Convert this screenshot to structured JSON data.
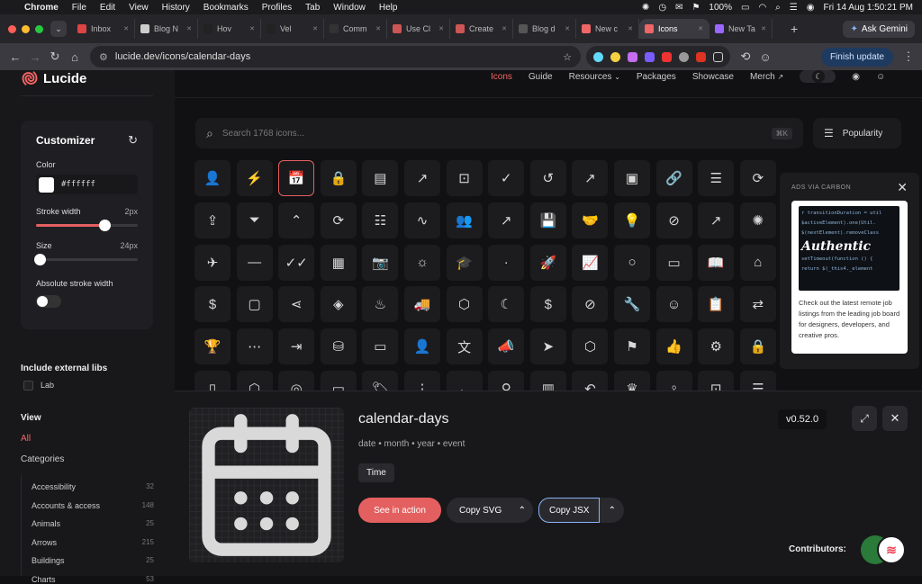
{
  "menubar": {
    "app": "Chrome",
    "items": [
      "File",
      "Edit",
      "View",
      "History",
      "Bookmarks",
      "Profiles",
      "Tab",
      "Window",
      "Help"
    ],
    "battery": "100%",
    "datetime": "Fri 14 Aug  1:50:21 PM"
  },
  "tabs": [
    {
      "label": "Inbox",
      "color": "#d44"
    },
    {
      "label": "Blog N",
      "color": "#ccc"
    },
    {
      "label": "Hov",
      "color": "#222"
    },
    {
      "label": "Vel",
      "color": "#222"
    },
    {
      "label": "Comm",
      "color": "#333"
    },
    {
      "label": "Use Cl",
      "color": "#c55"
    },
    {
      "label": "Create",
      "color": "#c55"
    },
    {
      "label": "Blog d",
      "color": "#555"
    },
    {
      "label": "New c",
      "color": "#e66"
    },
    {
      "label": "Icons",
      "color": "#e66",
      "active": true
    },
    {
      "label": "New Ta",
      "color": "#96f"
    }
  ],
  "browser": {
    "ask_gemini": "Ask Gemini",
    "url": "lucide.dev/icons/calendar-days",
    "finish_update": "Finish update"
  },
  "site": {
    "logo": "Lucide",
    "nav": [
      "Icons",
      "Guide",
      "Resources",
      "Packages",
      "Showcase",
      "Merch"
    ],
    "search_placeholder": "Search 1768 icons...",
    "search_shortcut": "⌘K",
    "sort_label": "Popularity"
  },
  "customizer": {
    "title": "Customizer",
    "color_label": "Color",
    "color_value": "#ffffff",
    "stroke_label": "Stroke width",
    "stroke_value": "2px",
    "stroke_fraction": 0.67,
    "size_label": "Size",
    "size_value": "24px",
    "size_fraction": 0.0,
    "absolute_label": "Absolute stroke width"
  },
  "libs": {
    "title": "Include external libs",
    "lab": "Lab"
  },
  "view": {
    "title": "View",
    "all": "All",
    "categories": "Categories"
  },
  "categories": [
    {
      "name": "Accessibility",
      "count": "32"
    },
    {
      "name": "Accounts & access",
      "count": "148"
    },
    {
      "name": "Animals",
      "count": "25"
    },
    {
      "name": "Arrows",
      "count": "215"
    },
    {
      "name": "Buildings",
      "count": "25"
    },
    {
      "name": "Charts",
      "count": "53"
    }
  ],
  "grid_icons": [
    [
      "👤",
      "⚡",
      "📅",
      "🔒",
      "▤",
      "↗",
      "⊡",
      "✓",
      "↺",
      "↗",
      "▣",
      "🔗",
      "☰",
      "⟳"
    ],
    [
      "⇪",
      "⏷",
      "⌃",
      "⟳",
      "☷",
      "∿",
      "👥",
      "↗",
      "💾",
      "🤝",
      "💡",
      "⊘",
      "↗",
      "✺"
    ],
    [
      "✈",
      "—",
      "✓✓",
      "▦",
      "📷",
      "☼",
      "🎓",
      "·",
      "🚀",
      "📈",
      "○",
      "▭",
      "📖",
      "⌂"
    ],
    [
      "$",
      "▢",
      "⋖",
      "◈",
      "♨",
      "🚚",
      "⬡",
      "☾",
      "$",
      "⊘",
      "🔧",
      "☺",
      "📋",
      "⇄"
    ],
    [
      "🏆",
      "⋯",
      "⇥",
      "⛁",
      "▭",
      "👤",
      "文",
      "📣",
      "➤",
      "⬡",
      "⚑",
      "👍",
      "⚙",
      "🔒"
    ],
    [
      "▯",
      "⬡",
      "◎",
      "▭",
      "🏷",
      "⋮",
      "←",
      "⚲",
      "▥",
      "↶",
      "♛",
      "♀",
      "⊡",
      "☰"
    ]
  ],
  "ads": {
    "header": "ADS VIA CARBON",
    "code": [
      "r transitionDuration = util",
      "$activeElement).one(Util.",
      "$(nextElement).removeClass",
      "Authentic",
      "setTimeout(function () {",
      "  return $(_this4._element"
    ],
    "text": "Check out the latest remote job listings from the leading job board for designers, developers, and creative pros."
  },
  "detail": {
    "name": "calendar-days",
    "tags": "date • month • year • event",
    "category": "Time",
    "version": "v0.52.0",
    "see_in_action": "See in action",
    "copy_svg": "Copy SVG",
    "copy_jsx": "Copy JSX",
    "contributors": "Contributors:"
  },
  "colors": {
    "accent": "#e46060",
    "brand": "#f56565"
  }
}
